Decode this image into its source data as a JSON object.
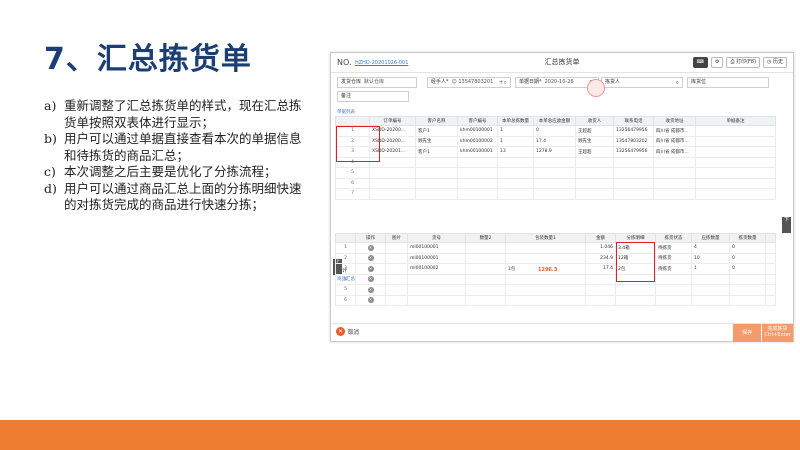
{
  "slide": {
    "title": "7、汇总拣货单",
    "bullets": [
      {
        "marker": "a)",
        "text": "重新调整了汇总拣货单的样式，现在汇总拣货单按照双表体进行显示；"
      },
      {
        "marker": "b)",
        "text": "用户可以通过单据直接查看本次的单据信息和待拣货的商品汇总；"
      },
      {
        "marker": "c)",
        "text": "本次调整之后主要是优化了分拣流程；"
      },
      {
        "marker": "d)",
        "text": "用户可以通过商品汇总上面的分拣明细快速的对拣货完成的商品进行快速分拣；"
      }
    ],
    "footer_color": "#ee7d31"
  },
  "app": {
    "no_label": "NO.",
    "no_value": "HZHD-20201026-001",
    "window_title": "汇总拣货单",
    "print_label": "打印(F8)",
    "more_label": "历史",
    "form": {
      "warehouse_label": "发货仓库",
      "warehouse_value": "默认仓库",
      "handler_label": "经手人*",
      "handler_value": "13547803201",
      "date_label": "单据日期*",
      "date_value": "2020-10-26",
      "picker_label": "拣货人",
      "location_label": "库货位",
      "remark_label": "备注"
    },
    "bill_section_label": "单据列表",
    "bill_columns": [
      "",
      "订单编号",
      "客户名称",
      "客户编号",
      "本单总拣数量",
      "本单总应收金额",
      "收货人",
      "联系电话",
      "收货地址",
      "单据备注"
    ],
    "bill_rows": [
      [
        "1",
        "XSDD-20200...",
        "客户1",
        "khm00100001",
        "1",
        "0",
        "王超超",
        "13256479956",
        "四川省 成都市...",
        ""
      ],
      [
        "2",
        "XSDD-20200...",
        "顾先生",
        "khm00100002",
        "1",
        "17.4",
        "顾先生",
        "13547803202",
        "四川省 成都市...",
        ""
      ],
      [
        "3",
        "XSDD-20201...",
        "客户1",
        "khm00100001",
        "13",
        "1278.9",
        "王超超",
        "13256479956",
        "四川省 成都市...",
        ""
      ]
    ],
    "bill_blank_rows": [
      "4",
      "5",
      "6",
      "7"
    ],
    "bill_total_label": "合计",
    "bill_total_amount": "1296.3",
    "goods_section_label": "商品汇总",
    "goods_columns": [
      "",
      "操作",
      "图片",
      "货号",
      "数量2",
      "包装数量1",
      "金额",
      "分拣明细",
      "拣货状态",
      "应拣数量",
      "拣货数量",
      ""
    ],
    "goods_rows": [
      [
        "1",
        "",
        "",
        "ml00100001",
        "",
        "",
        "1.046",
        "3.4箱",
        "待拣货",
        "4",
        "0",
        ""
      ],
      [
        "2",
        "",
        "",
        "ml00100001",
        "",
        "",
        "234.9",
        "12箱",
        "待拣货",
        "10",
        "0",
        ""
      ],
      [
        "3",
        "",
        "",
        "ml00100002",
        "",
        "1包",
        "17.4",
        "2包",
        "待拣货",
        "1",
        "0",
        ""
      ]
    ],
    "goods_blank_rows": [
      "4",
      "5",
      "6"
    ],
    "side_up": "上",
    "side_down": "下",
    "cancel_label": "取消",
    "save_label": "保存",
    "finish_label": "完成拣货",
    "finish_shortcut": "Ctrl+Enter",
    "accent_color": "#3a7bd5",
    "highlight_color": "#e02020"
  }
}
